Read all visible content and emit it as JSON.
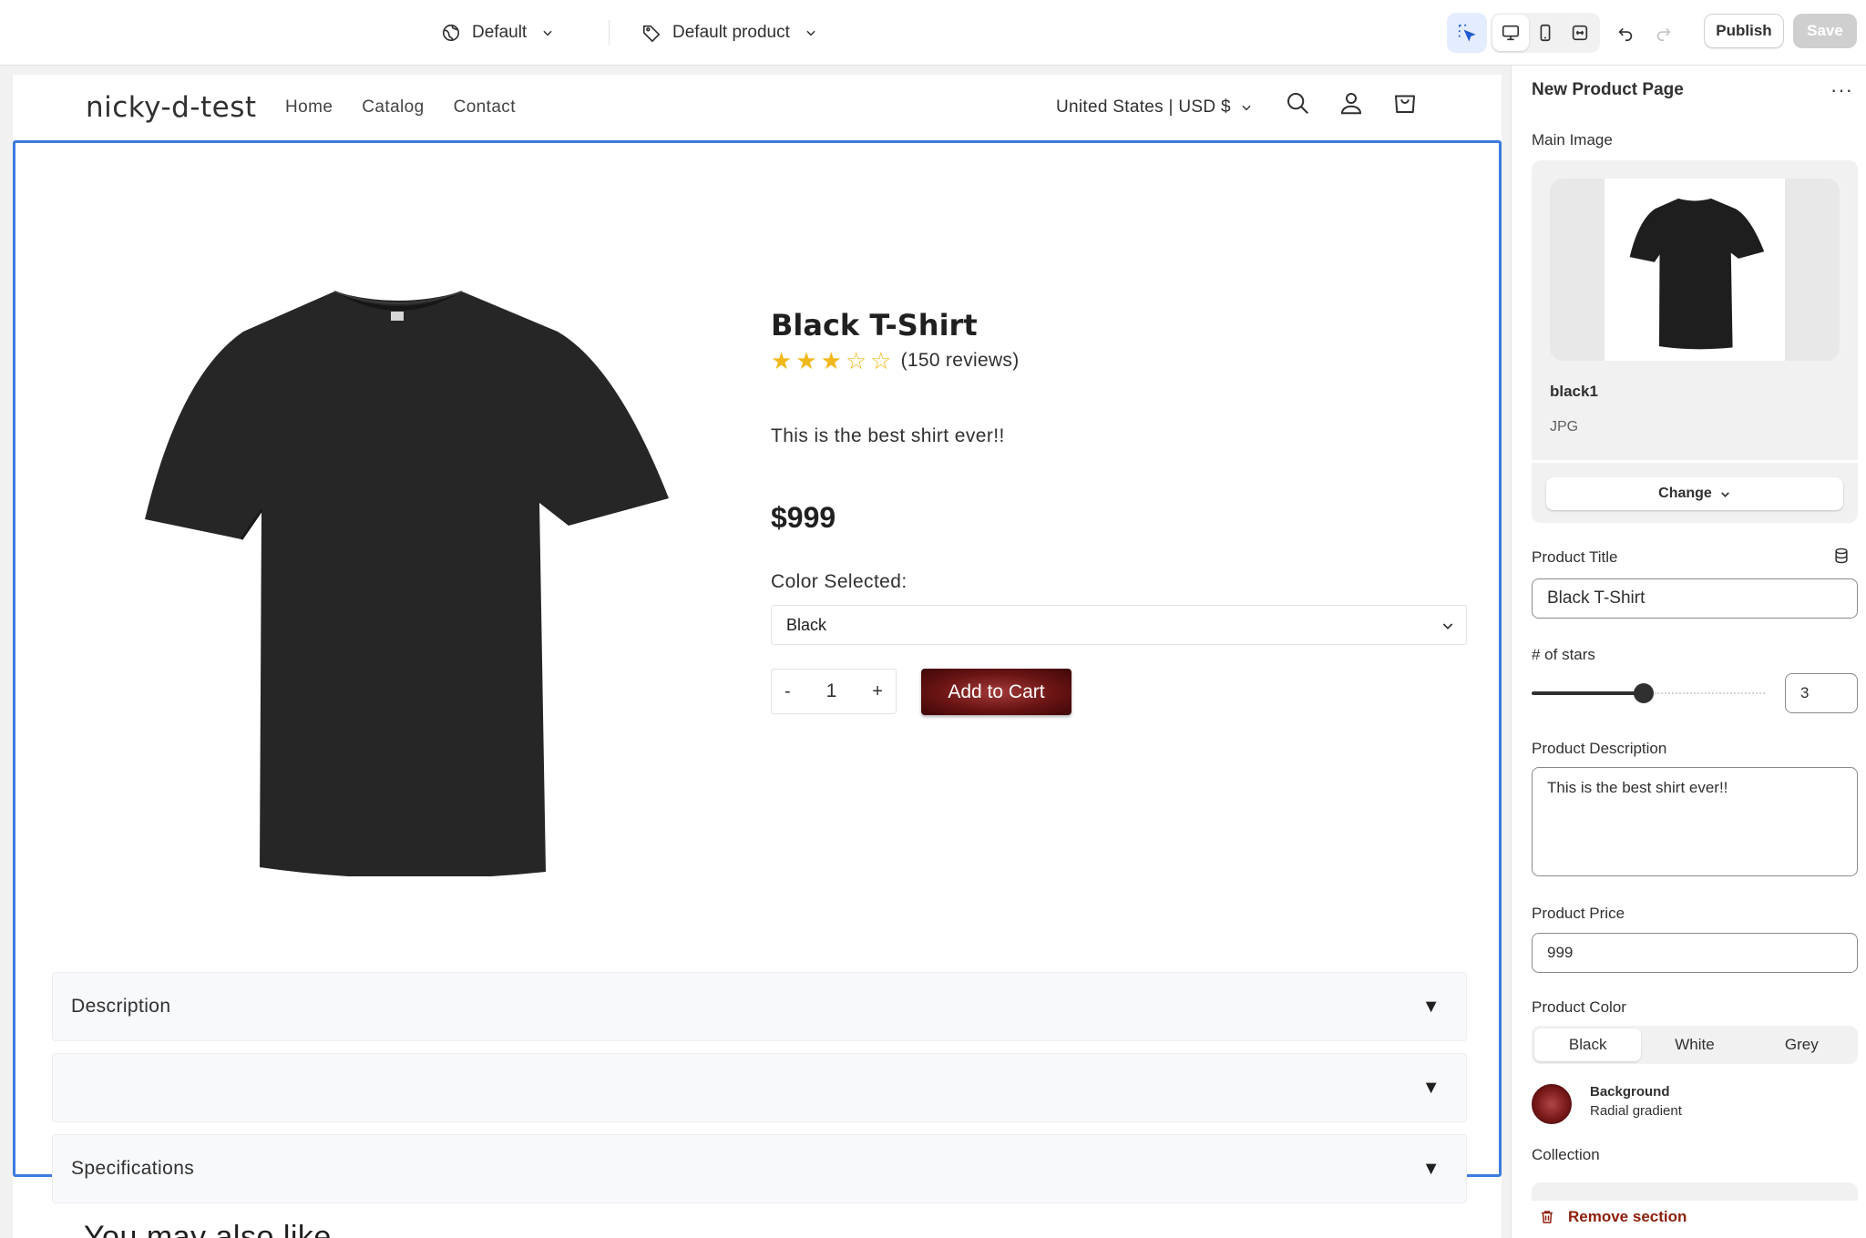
{
  "toolbar": {
    "theme_label": "Default",
    "template_label": "Default product",
    "publish_label": "Publish",
    "save_label": "Save"
  },
  "store": {
    "logo": "nicky-d-test",
    "nav": [
      "Home",
      "Catalog",
      "Contact"
    ],
    "locale": "United States | USD $"
  },
  "product": {
    "title": "Black T-Shirt",
    "rating": 3,
    "max_rating": 5,
    "reviews": "(150 reviews)",
    "description": "This is the best shirt ever!!",
    "price": "$999",
    "color_label": "Color Selected:",
    "color_value": "Black",
    "qty_minus": "-",
    "qty_value": "1",
    "qty_plus": "+",
    "add_to_cart": "Add to Cart",
    "accordions": [
      "Description",
      "",
      "Specifications"
    ],
    "accordion_icon": "▼"
  },
  "also_like": "You may also like",
  "panel": {
    "title": "New Product Page",
    "more": "···",
    "main_image_label": "Main Image",
    "image_name": "black1",
    "image_type": "JPG",
    "change_label": "Change",
    "product_title_label": "Product Title",
    "product_title_value": "Black T-Shirt",
    "stars_label": "# of stars",
    "stars_value": "3",
    "stars_max": 5,
    "description_label": "Product Description",
    "description_value": "This is the best shirt ever!!",
    "price_label": "Product Price",
    "price_value": "999",
    "color_label": "Product Color",
    "colors": [
      "Black",
      "White",
      "Grey"
    ],
    "selected_color": "Black",
    "background_title": "Background",
    "background_sub": "Radial gradient",
    "collection_label": "Collection",
    "remove_label": "Remove section"
  },
  "colors": {
    "accent": "#3d7be0",
    "cart_button": "#6a1414",
    "star": "#f0b81a",
    "danger": "#8e1f0b"
  }
}
